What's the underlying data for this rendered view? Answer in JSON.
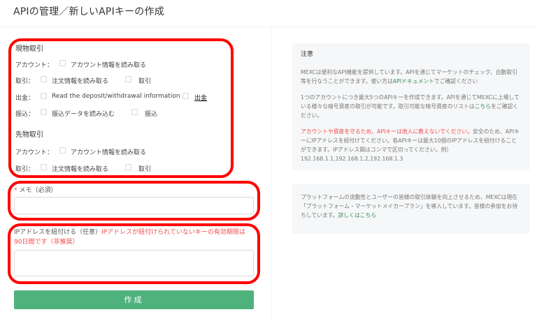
{
  "page_title": "APIの管理／新しいAPIキーの作成",
  "spot": {
    "title": "現物取引",
    "account": {
      "label": "アカウント：",
      "opt1": "アカウント情報を読み取る"
    },
    "trade": {
      "label": "取引：",
      "opt1": "注文情報を読み取る",
      "opt2": "取引"
    },
    "withdraw": {
      "label": "出金：",
      "opt1": "Read the deposit/withdrawal information",
      "opt2": "出金"
    },
    "transfer": {
      "label": "振込：",
      "opt1": "振込データを読み込む",
      "opt2": "振込"
    }
  },
  "futures": {
    "title": "先物取引",
    "account": {
      "label": "アカウント：",
      "opt1": "アカウント情報を読み取る"
    },
    "trade": {
      "label": "取引：",
      "opt1": "注文情報を読み取る",
      "opt2": "取引"
    }
  },
  "memo": {
    "required": "*",
    "label": "メモ（必須）",
    "value": ""
  },
  "ip": {
    "label_prefix": "IPアドレスを紐付ける（任意）",
    "label_warning": "IPアドレスが紐付けられていないキーの有効期限は90日間です（非推奨）",
    "value": ""
  },
  "create_button": "作成",
  "notice": {
    "title": "注意",
    "p1_text": "MEXCは便利なAPI機能を提供しています。APIを通じてマーケットのチェック、自動取引等を行なうことができます。使い方は",
    "p1_link": "APIドキュメント",
    "p1_tail": "でご確認ください",
    "p2_text": "1つのアカウントにつき最大5つのAPIキーを作成できます。APIを通じてMEXCに上場している様々な暗号資産の取引が可能です。取引可能な暗号資産のリストは",
    "p2_link": "こちら",
    "p2_tail": "をご確認ください。",
    "p3_warn": "アカウントや資産を守るため、APIキーは他人に教えないでください。",
    "p3_text": "安全のため、APIキーにIPアドレスを紐付けてください。各APIキーは最大10個のIPアドレスを紐付けることができます。IPアドレス間はコンマで区切ってください。例）192.168.1.1,192.168.1.2,192.168.1.3"
  },
  "mm_notice": {
    "text": "プラットフォームの流動性とユーザーの皆様の取引体験を向上させるため、MEXCは現在「プラットフォーム・マーケットメイカープラン」を導入しています。皆様の参加をお待ちしています。",
    "link": "詳しくはこちら"
  },
  "colors": {
    "accent": "#4fb27c",
    "annotation": "#ff0000",
    "warning": "#f04e4e"
  }
}
